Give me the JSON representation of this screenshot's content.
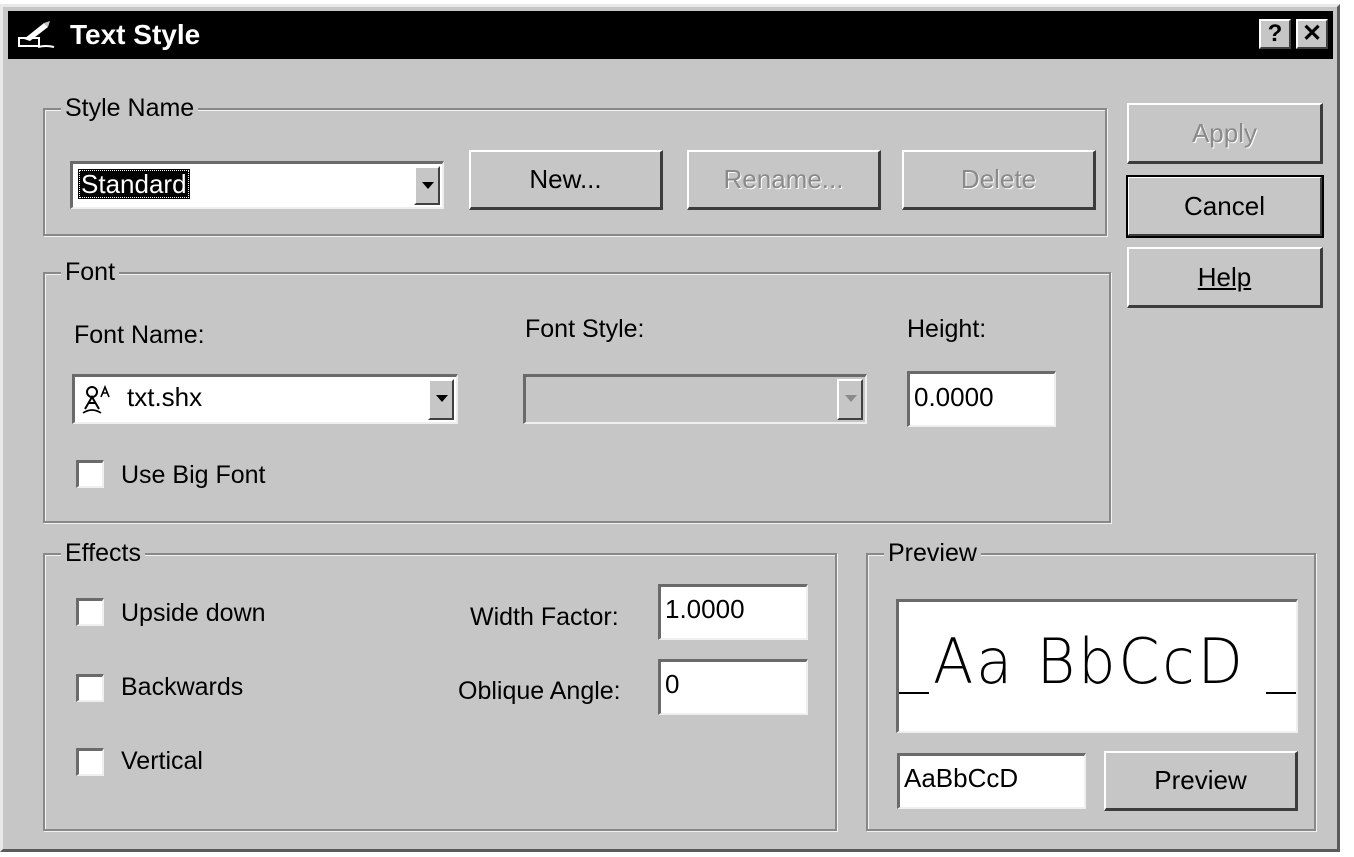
{
  "window": {
    "title": "Text Style",
    "help_glyph": "?",
    "close_glyph": "✕"
  },
  "side_buttons": {
    "apply": "Apply",
    "cancel": "Cancel",
    "help": "Help"
  },
  "style_name": {
    "group_label": "Style Name",
    "selected": "Standard",
    "new_label": "New...",
    "rename_label": "Rename...",
    "delete_label": "Delete"
  },
  "font": {
    "group_label": "Font",
    "font_name_label": "Font Name:",
    "font_name_value": "txt.shx",
    "font_name_icon": "shx-font-icon",
    "font_style_label": "Font Style:",
    "font_style_value": "",
    "height_label": "Height:",
    "height_value": "0.0000",
    "use_big_font_label": "Use Big Font",
    "use_big_font_checked": false
  },
  "effects": {
    "group_label": "Effects",
    "upside_down_label": "Upside down",
    "upside_down_checked": false,
    "backwards_label": "Backwards",
    "backwards_checked": false,
    "vertical_label": "Vertical",
    "vertical_checked": false,
    "width_factor_label": "Width Factor:",
    "width_factor_value": "1.0000",
    "oblique_angle_label": "Oblique Angle:",
    "oblique_angle_value": "0"
  },
  "preview": {
    "group_label": "Preview",
    "sample_display": "Aa BbCcD",
    "input_value": "AaBbCcD",
    "button_label": "Preview"
  },
  "colors": {
    "dialog_face": "#c6c6c6",
    "titlebar": "#000000",
    "disabled_text": "#8a8a8a"
  }
}
